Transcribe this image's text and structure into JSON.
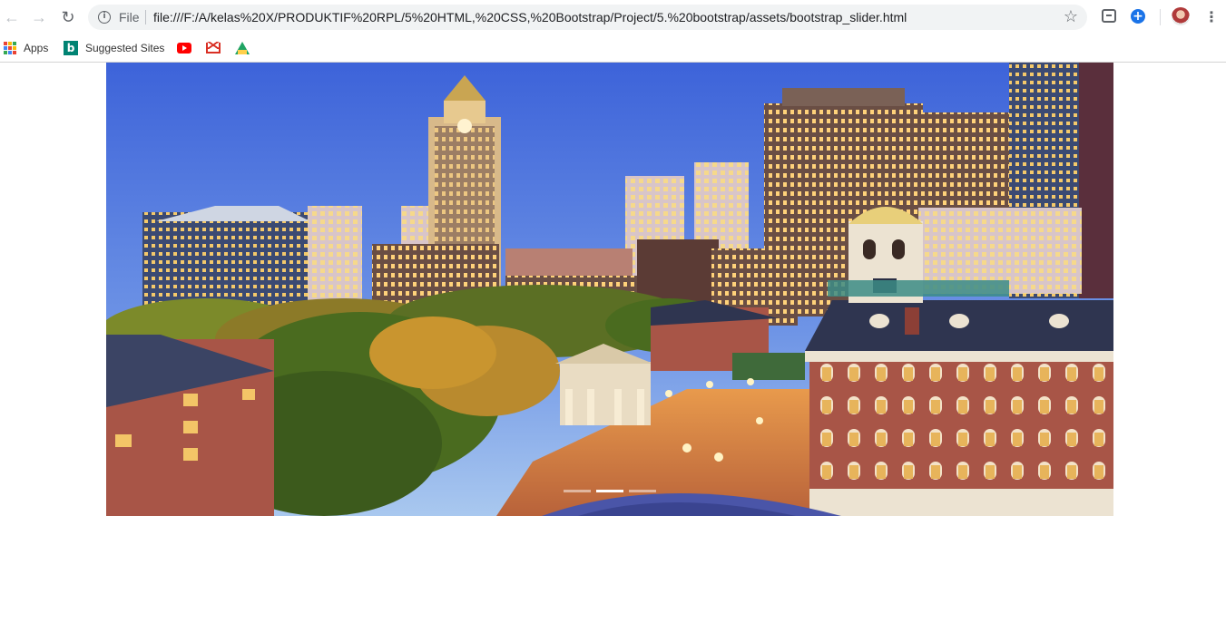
{
  "browser": {
    "scheme_label": "File",
    "url": "file:///F:/A/kelas%20X/PRODUKTIF%20RPL/5%20HTML,%20CSS,%20Bootstrap/Project/5.%20bootstrap/assets/bootstrap_slider.html"
  },
  "bookmarks": {
    "apps_label": "Apps",
    "suggested_label": "Suggested Sites"
  },
  "carousel": {
    "active_index": 1,
    "slide_count": 3
  },
  "colors": {
    "sky_top": "#3d63d9",
    "sky_bottom": "#a9c8ef",
    "brick": "#a85547",
    "roof": "#2f3550",
    "tree": "#4a6b1f"
  }
}
